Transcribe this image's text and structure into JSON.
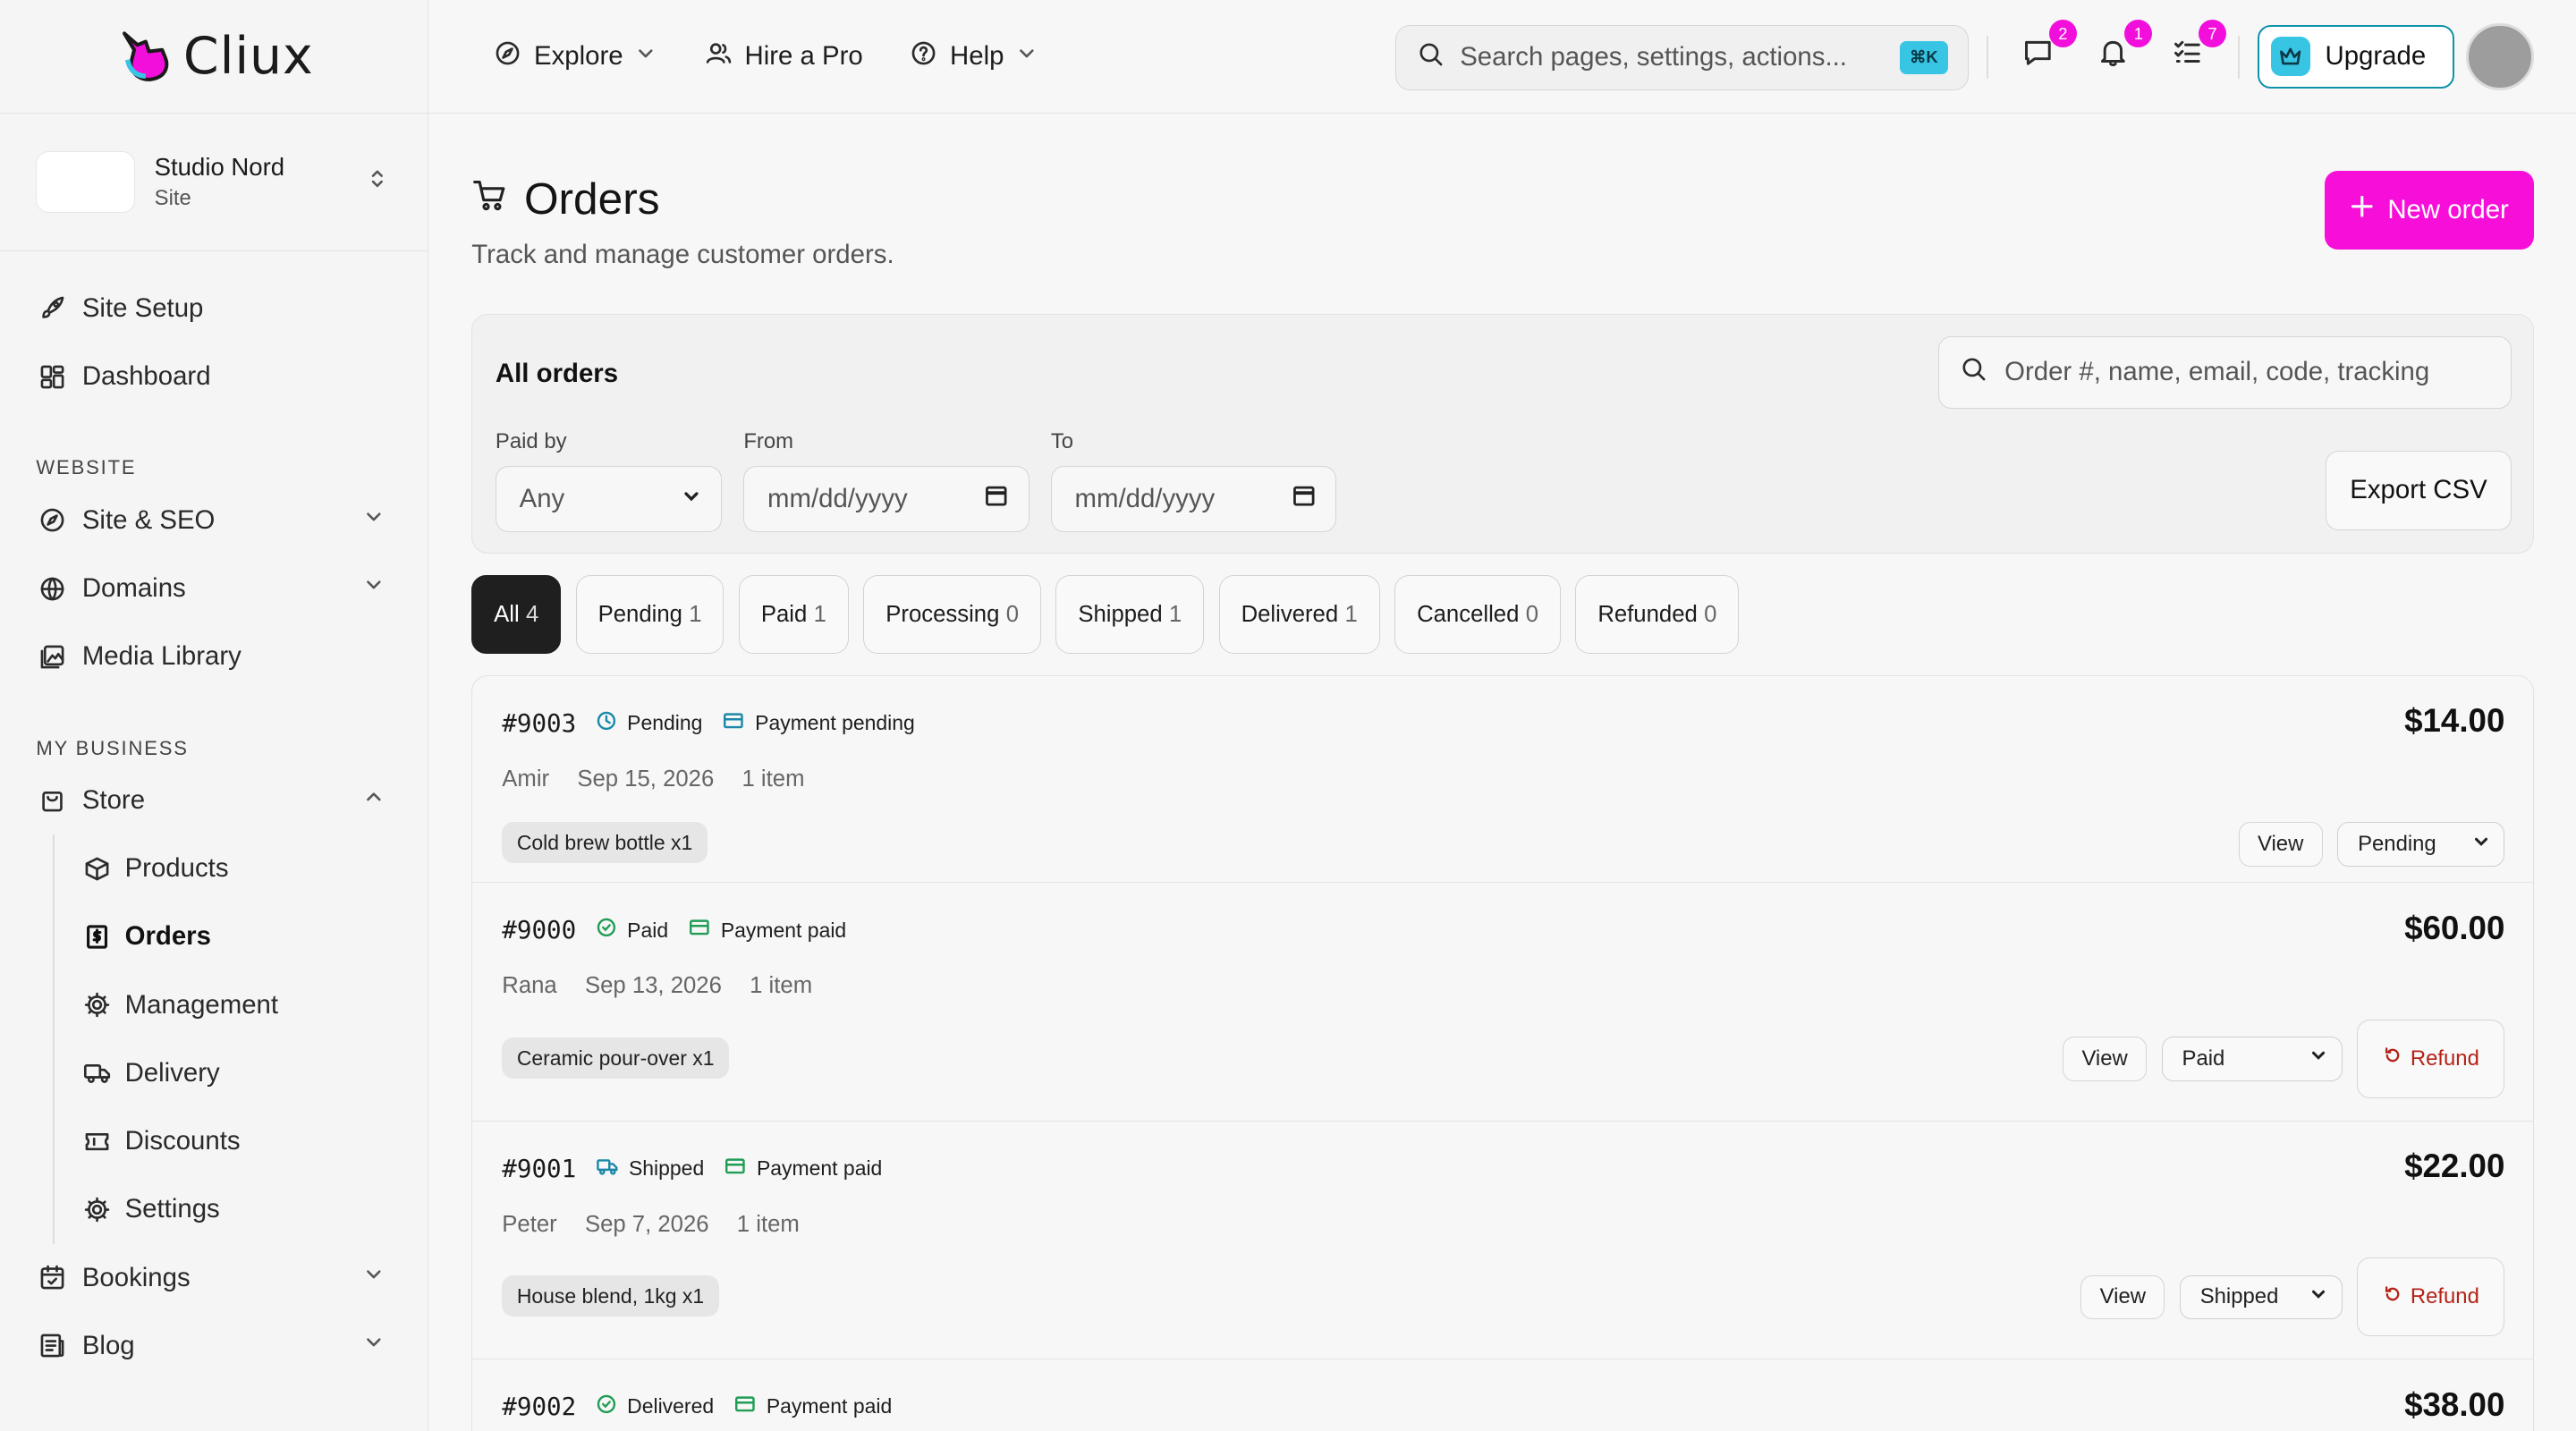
{
  "brand": {
    "name": "Cliux"
  },
  "site": {
    "name": "Studio Nord",
    "type": "Site"
  },
  "topnav": [
    {
      "label": "Explore"
    },
    {
      "label": "Hire a Pro"
    },
    {
      "label": "Help"
    }
  ],
  "search": {
    "placeholder": "Search pages, settings, actions...",
    "shortcut": "⌘K"
  },
  "notifications": {
    "messages": "2",
    "alerts": "1",
    "tasks": "7"
  },
  "upgrade_label": "Upgrade",
  "sidebar": {
    "top_items": [
      {
        "label": "Site Setup"
      },
      {
        "label": "Dashboard"
      }
    ],
    "website_header": "WEBSITE",
    "website_items": [
      {
        "label": "Site & SEO"
      },
      {
        "label": "Domains"
      },
      {
        "label": "Media Library"
      }
    ],
    "business_header": "MY BUSINESS",
    "store_label": "Store",
    "store_items": [
      {
        "label": "Products"
      },
      {
        "label": "Orders"
      },
      {
        "label": "Management"
      },
      {
        "label": "Delivery"
      },
      {
        "label": "Discounts"
      },
      {
        "label": "Settings"
      }
    ],
    "bottom_items": [
      {
        "label": "Bookings"
      },
      {
        "label": "Blog"
      }
    ]
  },
  "page": {
    "title": "Orders",
    "subtitle": "Track and manage customer orders.",
    "new_order_label": "New order"
  },
  "filters": {
    "title": "All orders",
    "search_placeholder": "Order #, name, email, code, tracking",
    "paid_by_label": "Paid by",
    "paid_by_value": "Any",
    "from_label": "From",
    "from_placeholder": "mm/dd/yyyy",
    "to_label": "To",
    "to_placeholder": "mm/dd/yyyy",
    "export_label": "Export CSV"
  },
  "tabs": [
    {
      "label": "All",
      "count": "4"
    },
    {
      "label": "Pending",
      "count": "1"
    },
    {
      "label": "Paid",
      "count": "1"
    },
    {
      "label": "Processing",
      "count": "0"
    },
    {
      "label": "Shipped",
      "count": "1"
    },
    {
      "label": "Delivered",
      "count": "1"
    },
    {
      "label": "Cancelled",
      "count": "0"
    },
    {
      "label": "Refunded",
      "count": "0"
    }
  ],
  "orders": [
    {
      "number": "#9003",
      "status": "Pending",
      "payment": "Payment pending",
      "customer": "Amir",
      "date": "Sep 15, 2026",
      "items_count": "1 item",
      "item": "Cold brew bottle x1",
      "total": "$14.00",
      "view": "View",
      "select_value": "Pending"
    },
    {
      "number": "#9000",
      "status": "Paid",
      "payment": "Payment paid",
      "customer": "Rana",
      "date": "Sep 13, 2026",
      "items_count": "1 item",
      "item": "Ceramic pour-over x1",
      "total": "$60.00",
      "view": "View",
      "select_value": "Paid",
      "refund": "Refund"
    },
    {
      "number": "#9001",
      "status": "Shipped",
      "payment": "Payment paid",
      "customer": "Peter",
      "date": "Sep 7, 2026",
      "items_count": "1 item",
      "item": "House blend, 1kg x1",
      "total": "$22.00",
      "view": "View",
      "select_value": "Shipped",
      "refund": "Refund"
    },
    {
      "number": "#9002",
      "status": "Delivered",
      "payment": "Payment paid",
      "total": "$38.00"
    }
  ],
  "colors": {
    "accent": "#f70fd9",
    "teal": "#38c5e4",
    "refund": "#b42318",
    "status_pending": "#1a88a8",
    "status_paid": "#1f9d55"
  }
}
